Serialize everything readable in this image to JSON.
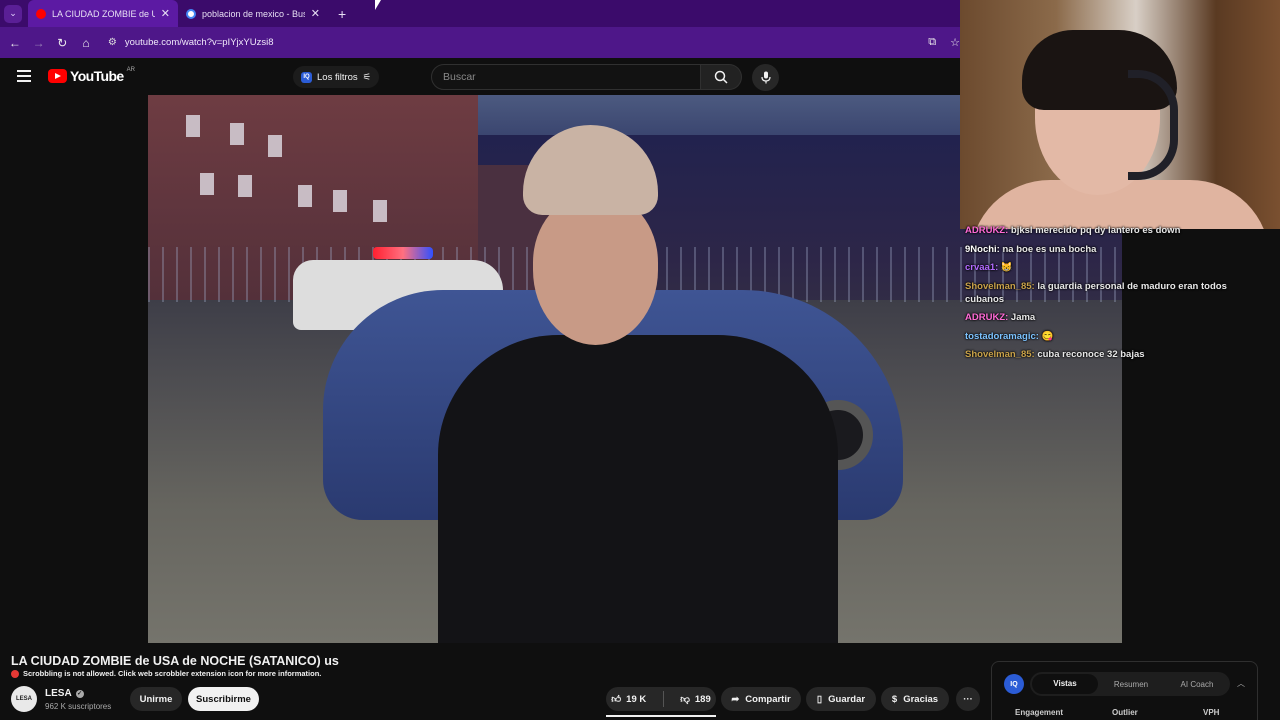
{
  "browser": {
    "tabs": [
      {
        "title": "LA CIUDAD ZOMBIE de USA de",
        "active": true,
        "favicon_color": "#ff0000"
      },
      {
        "title": "poblacion de mexico - Buscar c",
        "active": false,
        "favicon_color": "#4285f4"
      }
    ],
    "url": "youtube.com/watch?v=pIYjxYUzsi8",
    "accent": "#4e1789"
  },
  "youtube": {
    "logo": "YouTube",
    "country": "AR",
    "filters_label": "Los filtros",
    "search_placeholder": "Buscar"
  },
  "chat": [
    {
      "user": "ADRUKZ:",
      "text": "bjksl merecido pq dy lantero es down",
      "color": "#ff6bd6"
    },
    {
      "user": "9Nochi:",
      "text": "na boe es una bocha",
      "color": "#ffffff"
    },
    {
      "user": "crvaa1:",
      "text": "😸",
      "color": "#b36bff"
    },
    {
      "user": "Shovelman_85:",
      "text": "la guardia personal de maduro eran todos cubanos",
      "color": "#c9a24a"
    },
    {
      "user": "ADRUKZ:",
      "text": "Jama",
      "color": "#ff6bd6"
    },
    {
      "user": "tostadoramagic:",
      "text": "😋",
      "color": "#7cc3ff"
    },
    {
      "user": "Shovelman_85:",
      "text": "cuba reconoce 32 bajas",
      "color": "#c9a24a"
    }
  ],
  "video": {
    "title": "LA CIUDAD ZOMBIE de USA de NOCHE (SATANICO) us",
    "scrobble_notice": "Scrobbling is not allowed. Click web scrobbler extension icon for more information.",
    "channel": "LESA",
    "subscribers": "962 K suscriptores",
    "join_label": "Unirme",
    "subscribe_label": "Suscribirme",
    "likes": "19 K",
    "dislikes": "189",
    "share_label": "Compartir",
    "save_label": "Guardar",
    "thanks_label": "Gracias",
    "more_label": "···"
  },
  "iq_panel": {
    "logo": "IQ",
    "tabs": [
      "Vistas",
      "Resumen",
      "AI Coach"
    ],
    "metrics": [
      "Engagement",
      "Outlier",
      "VPH"
    ]
  }
}
